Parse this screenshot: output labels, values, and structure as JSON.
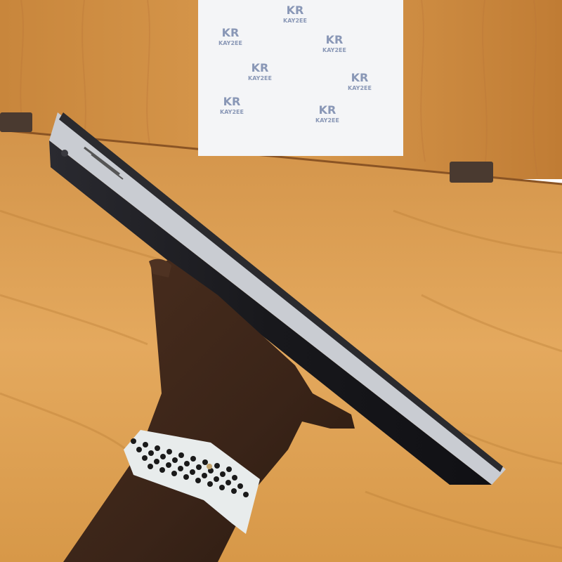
{
  "scene": {
    "description_free": true,
    "watermark": {
      "monogram": "KR",
      "brand": "KAY2EE",
      "tiles": 7
    },
    "colors": {
      "wood_light": "#e2a65a",
      "wood_mid": "#c98a3e",
      "wood_dark": "#a86a2a",
      "laptop_body": "#1e1e22",
      "laptop_edge": "#c9ccd2",
      "skin": "#3a2418",
      "band": "#e8ecec",
      "band_holes": "#1a1a1a",
      "poster": "#f4f5f7",
      "watermark_blue": "#5b6f9a"
    }
  }
}
